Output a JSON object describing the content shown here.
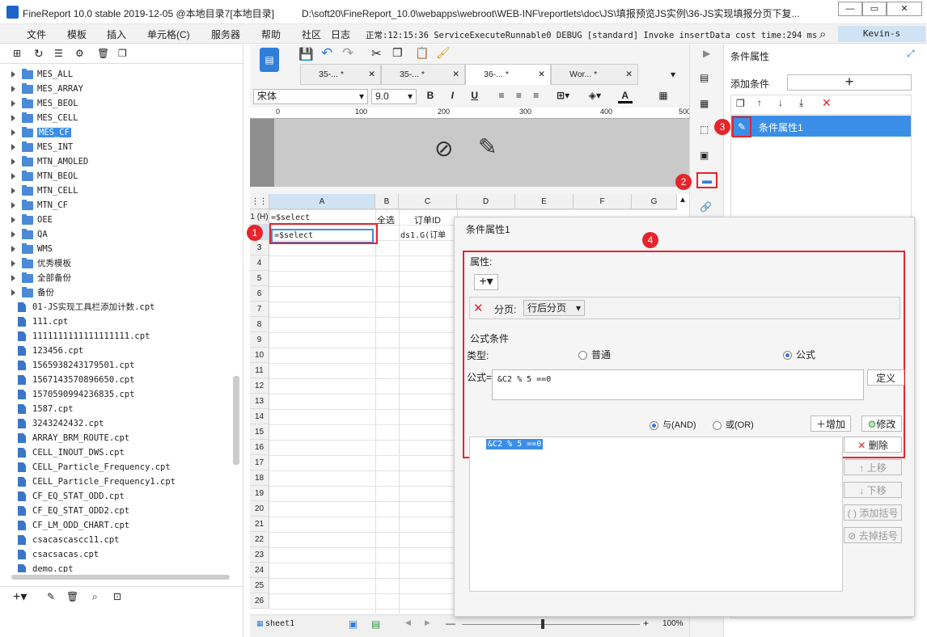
{
  "app": {
    "title": "FineReport 10.0 stable 2019-12-05 @本地目录7[本地目录]",
    "path": "D:\\soft20\\FineReport_10.0\\webapps\\webroot\\WEB-INF\\reportlets\\doc\\JS\\填报预览JS实例\\36-JS实现填报分页下复..."
  },
  "menu": {
    "items": [
      "文件",
      "模板",
      "插入",
      "单元格(C)",
      "服务器",
      "帮助",
      "社区",
      "日志"
    ],
    "log_line": "正常:12:15:36 ServiceExecuteRunnable0 DEBUG [standard] Invoke insertData cost time:294 ms",
    "user": "Kevin-s"
  },
  "tree": {
    "folders": [
      "MES_ALL",
      "MES_ARRAY",
      "MES_BEOL",
      "MES_CELL",
      "MES_CF",
      "MES_INT",
      "MTN_AMOLED",
      "MTN_BEOL",
      "MTN_CELL",
      "MTN_CF",
      "OEE",
      "QA",
      "WMS",
      "优秀模板",
      "全部备份",
      "备份"
    ],
    "selected": "MES_CF",
    "files": [
      "01-JS实现工具栏添加计数.cpt",
      "111.cpt",
      "1111111111111111111.cpt",
      "123456.cpt",
      "1565938243179501.cpt",
      "1567143570896650.cpt",
      "1570590994236835.cpt",
      "1587.cpt",
      "3243242432.cpt",
      "ARRAY_BRM_ROUTE.cpt",
      "CELL_INOUT_DWS.cpt",
      "CELL_Particle_Frequency.cpt",
      "CELL_Particle_Frequency1.cpt",
      "CF_EQ_STAT_ODD.cpt",
      "CF_EQ_STAT_ODD2.cpt",
      "CF_LM_ODD_CHART.cpt",
      "csacascascc11.cpt",
      "csacsacas.cpt",
      "demo.cpt"
    ]
  },
  "editor": {
    "tabs": [
      "35-... *",
      "35-... *",
      "36-... *",
      "Wor... *"
    ],
    "font": "宋体",
    "font_size": "9.0",
    "ruler": [
      "0",
      "100",
      "200",
      "300",
      "400",
      "500"
    ],
    "columns": [
      "A",
      "B",
      "C",
      "D",
      "E",
      "F",
      "G"
    ],
    "rows": [
      "1 (H)",
      "2",
      "3",
      "4",
      "5",
      "6",
      "7",
      "8",
      "9",
      "10",
      "11",
      "12",
      "13",
      "14",
      "15",
      "16",
      "17",
      "18",
      "19",
      "20",
      "21",
      "22",
      "23",
      "24",
      "25",
      "26"
    ],
    "cells": {
      "a1": "=$select",
      "b1": "全选",
      "c1": "订单ID",
      "a2": "=$select",
      "c2": "ds1.G(订单"
    },
    "sheet": "sheet1",
    "zoom": "100%"
  },
  "right_panel": {
    "title": "条件属性",
    "add_condition": "添加条件",
    "item": "条件属性1"
  },
  "dialog": {
    "title": "条件属性1",
    "section_attr": "属性:",
    "pagination_label": "分页:",
    "pagination_value": "行后分页",
    "section_formula": "公式条件",
    "type_label": "类型:",
    "opt_normal": "普通",
    "opt_formula": "公式",
    "formula_label": "公式=",
    "formula": "&C2 % 5 ==0",
    "define_btn": "定义",
    "and_label": "与(AND)",
    "or_label": "或(OR)",
    "add_btn": "增加",
    "modify_btn": "修改",
    "list_item": "&C2 % 5 ==0",
    "delete_btn": "删除",
    "up_btn": "上移",
    "down_btn": "下移",
    "add_bracket": "添加括号",
    "remove_bracket": "去掉括号"
  },
  "badges": [
    "1",
    "2",
    "3",
    "4"
  ],
  "colors": {
    "accent": "#3b8ee8",
    "red": "#e5242b",
    "header_sel": "#cfe3f5"
  }
}
